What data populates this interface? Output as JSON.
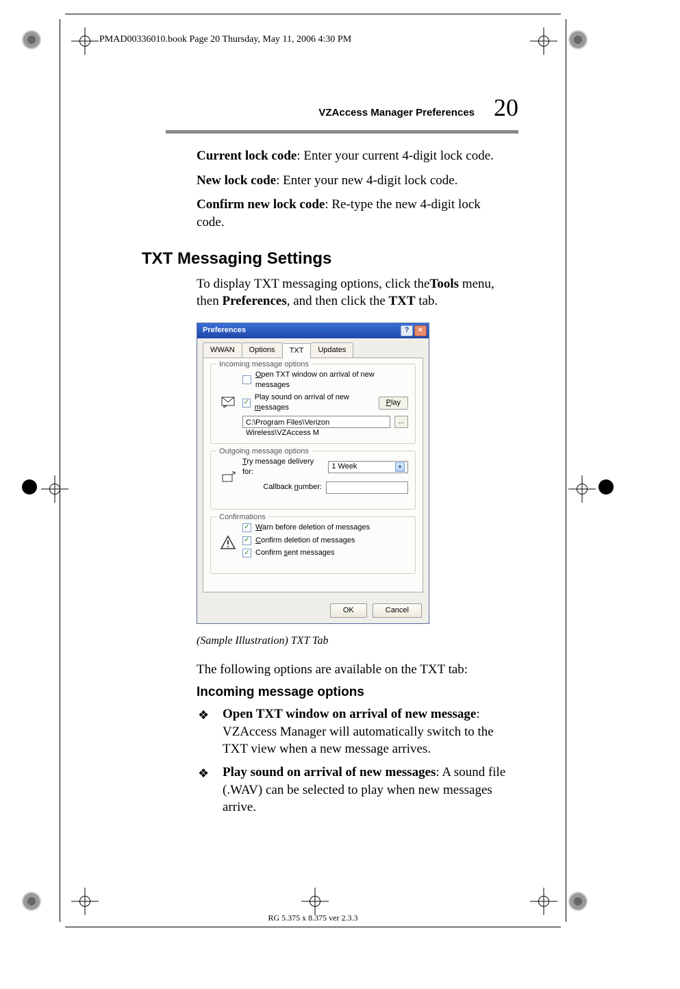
{
  "book_header": "PMAD00336010.book  Page 20  Thursday, May 11, 2006  4:30 PM",
  "running_head": {
    "title": "VZAccess Manager Preferences",
    "page_num": "20"
  },
  "lock_code": {
    "current": {
      "label": "Current lock code",
      "desc": ": Enter your current 4-digit lock code."
    },
    "new_": {
      "label": "New lock code",
      "desc": ": Enter your new 4-digit lock code."
    },
    "confirm": {
      "label": "Confirm new lock code",
      "desc": ": Re-type the new 4-digit lock code."
    }
  },
  "section_heading": "TXT Messaging Settings",
  "intro": {
    "part1": "To display TXT messaging options, click the",
    "bold1": "Tools",
    "part2": " menu, then ",
    "bold2": "Preferences",
    "part3": ", and then click the ",
    "bold3": "TXT",
    "part4": " tab."
  },
  "dialog": {
    "title": "Preferences",
    "help_btn": "?",
    "close_btn": "×",
    "tabs": {
      "wwan": "WWAN",
      "options": "Options",
      "txt": "TXT",
      "updates": "Updates"
    },
    "incoming": {
      "legend": "Incoming message options",
      "open_prefix": "O",
      "open_rest": "pen TXT window on arrival of new messages",
      "play_sound_text": "Play sound on arrival of new ",
      "play_sound_u": "m",
      "play_sound_rest": "essages",
      "play_btn_u": "P",
      "play_btn_rest": "lay",
      "sound_path": "C:\\Program Files\\Verizon Wireless\\VZAccess M",
      "browse": "..."
    },
    "outgoing": {
      "legend": "Outgoing message options",
      "try_u": "T",
      "try_rest": "ry message delivery for:",
      "try_value": "1 Week",
      "callback_text": "Callback ",
      "callback_u": "n",
      "callback_rest": "umber:",
      "callback_value": ""
    },
    "confirmations": {
      "legend": "Confirmations",
      "warn_u": "W",
      "warn_rest": "arn before deletion of messages",
      "confirm_u": "C",
      "confirm_rest": "onfirm deletion of messages",
      "sent_text": "Confirm ",
      "sent_u": "s",
      "sent_rest": "ent messages"
    },
    "ok": "OK",
    "cancel": "Cancel"
  },
  "caption": "(Sample Illustration) TXT Tab",
  "after_caption": "The following options are available on the TXT tab:",
  "sub_heading": "Incoming message options",
  "bullets": [
    {
      "bold": "Open TXT window on arrival of new message",
      "rest": ": VZAccess Manager will automatically switch to the TXT view when a new message arrives."
    },
    {
      "bold": "Play sound on arrival of new messages",
      "rest": ": A sound file (.WAV) can be selected to play when new messages arrive."
    }
  ],
  "footer": "RG 5.375 x 8.375 ver 2.3.3"
}
